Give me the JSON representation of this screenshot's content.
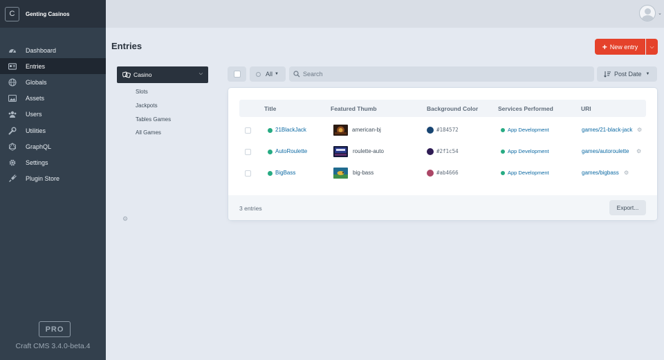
{
  "site": {
    "icon_letter": "C",
    "name": "Genting Casinos"
  },
  "nav": [
    {
      "label": "Dashboard",
      "icon": "dashboard-icon"
    },
    {
      "label": "Entries",
      "icon": "entries-icon",
      "active": true
    },
    {
      "label": "Globals",
      "icon": "globe-icon"
    },
    {
      "label": "Assets",
      "icon": "image-icon"
    },
    {
      "label": "Users",
      "icon": "users-icon"
    },
    {
      "label": "Utilities",
      "icon": "wrench-icon"
    },
    {
      "label": "GraphQL",
      "icon": "graphql-icon"
    },
    {
      "label": "Settings",
      "icon": "gear-icon"
    },
    {
      "label": "Plugin Store",
      "icon": "plug-icon"
    }
  ],
  "edition": {
    "badge": "PRO",
    "version": "Craft CMS 3.4.0-beta.4"
  },
  "page": {
    "title": "Entries"
  },
  "actions": {
    "new_entry": "New entry"
  },
  "sources": {
    "active": "Casino",
    "items": [
      "Slots",
      "Jackpots",
      "Tables Games",
      "All Games"
    ]
  },
  "toolbar": {
    "status": "All",
    "search_placeholder": "Search",
    "sort": "Post Date"
  },
  "table": {
    "headers": [
      "Title",
      "Featured Thumb",
      "Background Color",
      "Services Performed",
      "URI"
    ],
    "rows": [
      {
        "title": "21BlackJack",
        "thumb": "american-bj",
        "color": "#184572",
        "color_label": "#184572",
        "service": "App Development",
        "uri": "games/21-black-jack"
      },
      {
        "title": "AutoRoulette",
        "thumb": "roulette-auto",
        "color": "#2f1c54",
        "color_label": "#2f1c54",
        "service": "App Development",
        "uri": "games/autoroulette"
      },
      {
        "title": "BigBass",
        "thumb": "big-bass",
        "color": "#ab4666",
        "color_label": "#ab4666",
        "service": "App Development",
        "uri": "games/bigbass"
      }
    ]
  },
  "footer": {
    "count": "3 entries",
    "export": "Export..."
  },
  "colors": {
    "accent": "#e5422b",
    "link": "#0b69a3",
    "status_live": "#27ab83",
    "sidebar": "#33404d"
  }
}
